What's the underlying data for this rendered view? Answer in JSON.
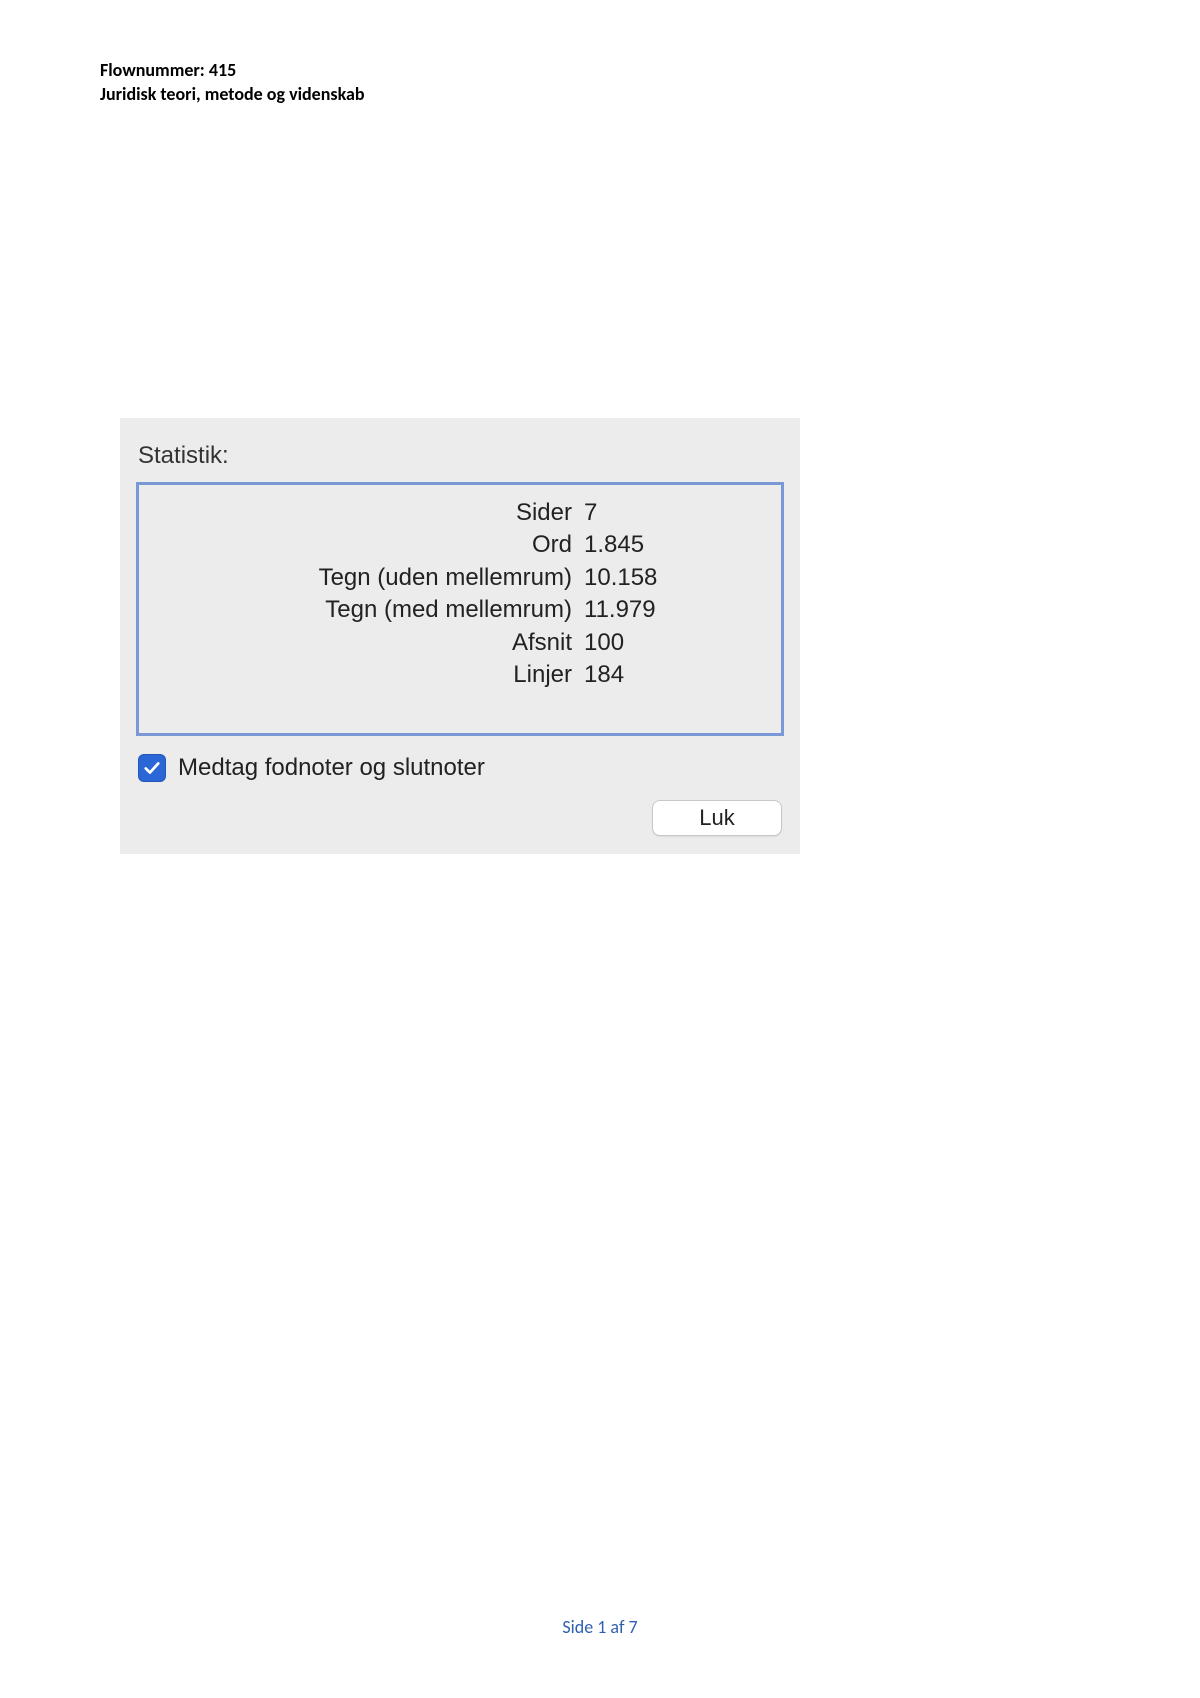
{
  "header": {
    "line1": "Flownummer: 415",
    "line2": "Juridisk teori, metode og videnskab"
  },
  "dialog": {
    "title": "Statistik:",
    "rows": [
      {
        "label": "Sider",
        "value": "7"
      },
      {
        "label": "Ord",
        "value": "1.845"
      },
      {
        "label": "Tegn (uden mellemrum)",
        "value": "10.158"
      },
      {
        "label": "Tegn (med mellemrum)",
        "value": "11.979"
      },
      {
        "label": "Afsnit",
        "value": "100"
      },
      {
        "label": "Linjer",
        "value": "184"
      }
    ],
    "checkbox_label": "Medtag fodnoter og slutnoter",
    "checkbox_checked": true,
    "close_label": "Luk"
  },
  "footer": {
    "page_text": "Side 1 af 7"
  }
}
